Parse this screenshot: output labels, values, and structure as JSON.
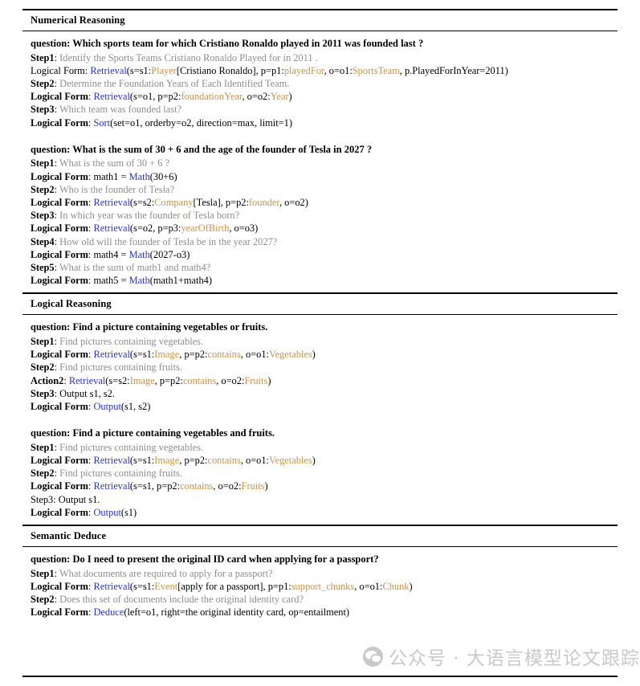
{
  "document": {
    "title": "Logical Form Reasoning Examples Table",
    "colors": {
      "operator": "#2a37d8",
      "type": "#d09344",
      "step_text": "#8e8e8e",
      "body_text": "#000000"
    }
  },
  "sections": [
    {
      "heading": "Numerical Reasoning",
      "examples": [
        {
          "question": "question: Which sports team for which Cristiano Ronaldo played in 2011 was founded last ?",
          "lines": [
            {
              "label": "Step1",
              "label_bold": true,
              "sep": ": ",
              "kind": "step",
              "parts": [
                {
                  "t": "Identify the Sports Teams Cristiano Ronaldo Played for in 2011 .",
                  "c": "step"
                }
              ]
            },
            {
              "label": "Logical Form",
              "label_bold": false,
              "sep": ": ",
              "kind": "form",
              "parts": [
                {
                  "t": "Retrieval",
                  "c": "op"
                },
                {
                  "t": "(s=s1:",
                  "c": "plain"
                },
                {
                  "t": "Player",
                  "c": "typ"
                },
                {
                  "t": "[Cristiano Ronaldo], p=p1:",
                  "c": "plain"
                },
                {
                  "t": "playedFor",
                  "c": "typ"
                },
                {
                  "t": ", o=o1:",
                  "c": "plain"
                },
                {
                  "t": "SportsTeam",
                  "c": "typ"
                },
                {
                  "t": ", p.PlayedForInYear=2011)",
                  "c": "plain"
                }
              ]
            },
            {
              "label": "Step2",
              "label_bold": true,
              "sep": ": ",
              "kind": "step",
              "parts": [
                {
                  "t": "Determine the Foundation Years of Each Identified Team.",
                  "c": "step"
                }
              ]
            },
            {
              "label": "Logical Form",
              "label_bold": true,
              "sep": ": ",
              "kind": "form",
              "parts": [
                {
                  "t": "Retrieval",
                  "c": "op"
                },
                {
                  "t": "(s=o1, p=p2:",
                  "c": "plain"
                },
                {
                  "t": "foundationYear",
                  "c": "typ"
                },
                {
                  "t": ", o=o2:",
                  "c": "plain"
                },
                {
                  "t": "Year",
                  "c": "typ"
                },
                {
                  "t": ")",
                  "c": "plain"
                }
              ]
            },
            {
              "label": "Step3",
              "label_bold": true,
              "sep": ": ",
              "kind": "step",
              "parts": [
                {
                  "t": "Which team was founded last?",
                  "c": "step"
                }
              ]
            },
            {
              "label": "Logical Form",
              "label_bold": true,
              "sep": ": ",
              "kind": "form",
              "parts": [
                {
                  "t": "Sort",
                  "c": "op"
                },
                {
                  "t": "(set=o1, orderby=o2, direction=max, limit=1)",
                  "c": "plain"
                }
              ]
            }
          ]
        },
        {
          "question": "question: What is the sum of 30 + 6 and the age of the founder of Tesla in 2027 ?",
          "lines": [
            {
              "label": "Step1",
              "label_bold": true,
              "sep": ": ",
              "kind": "step",
              "parts": [
                {
                  "t": "What is the sum of 30 + 6 ?",
                  "c": "step"
                }
              ]
            },
            {
              "label": "Logical Form",
              "label_bold": true,
              "sep": ": ",
              "kind": "form",
              "parts": [
                {
                  "t": "math1 = ",
                  "c": "plain"
                },
                {
                  "t": "Math",
                  "c": "op"
                },
                {
                  "t": "(30+6)",
                  "c": "plain"
                }
              ]
            },
            {
              "label": "Step2",
              "label_bold": true,
              "sep": ": ",
              "kind": "step",
              "parts": [
                {
                  "t": "Who is the founder of Tesla?",
                  "c": "step"
                }
              ]
            },
            {
              "label": "Logical Form",
              "label_bold": true,
              "sep": ": ",
              "kind": "form",
              "parts": [
                {
                  "t": "Retrieval",
                  "c": "op"
                },
                {
                  "t": "(s=s2:",
                  "c": "plain"
                },
                {
                  "t": "Company",
                  "c": "typ"
                },
                {
                  "t": "[Tesla], p=p2:",
                  "c": "plain"
                },
                {
                  "t": "founder",
                  "c": "typ"
                },
                {
                  "t": ", o=o2)",
                  "c": "plain"
                }
              ]
            },
            {
              "label": "Step3",
              "label_bold": true,
              "sep": ": ",
              "kind": "step",
              "parts": [
                {
                  "t": "In which year was the founder of Tesla born?",
                  "c": "step"
                }
              ]
            },
            {
              "label": "Logical Form",
              "label_bold": true,
              "sep": ": ",
              "kind": "form",
              "parts": [
                {
                  "t": "Retrieval",
                  "c": "op"
                },
                {
                  "t": "(s=o2, p=p3:",
                  "c": "plain"
                },
                {
                  "t": "yearOfBirth",
                  "c": "typ"
                },
                {
                  "t": ", o=o3)",
                  "c": "plain"
                }
              ]
            },
            {
              "label": "Step4",
              "label_bold": true,
              "sep": ": ",
              "kind": "step",
              "parts": [
                {
                  "t": "How old will the founder of Tesla be in the year 2027?",
                  "c": "step"
                }
              ]
            },
            {
              "label": "Logical Form",
              "label_bold": true,
              "sep": ": ",
              "kind": "form",
              "parts": [
                {
                  "t": "math4 = ",
                  "c": "plain"
                },
                {
                  "t": "Math",
                  "c": "op"
                },
                {
                  "t": "(2027-o3)",
                  "c": "plain"
                }
              ]
            },
            {
              "label": "Step5",
              "label_bold": true,
              "sep": ": ",
              "kind": "step",
              "parts": [
                {
                  "t": "What is the sum of math1 and math4?",
                  "c": "step"
                }
              ]
            },
            {
              "label": "Logical Form",
              "label_bold": true,
              "sep": ": ",
              "kind": "form",
              "parts": [
                {
                  "t": "math5 = ",
                  "c": "plain"
                },
                {
                  "t": "Math",
                  "c": "op"
                },
                {
                  "t": "(math1+math4)",
                  "c": "plain"
                }
              ]
            }
          ]
        }
      ]
    },
    {
      "heading": "Logical Reasoning",
      "examples": [
        {
          "question": "question: Find a picture containing vegetables or fruits.",
          "lines": [
            {
              "label": "Step1",
              "label_bold": true,
              "sep": ": ",
              "kind": "step",
              "parts": [
                {
                  "t": "Find pictures containing vegetables.",
                  "c": "step"
                }
              ]
            },
            {
              "label": "Logical Form",
              "label_bold": true,
              "sep": ": ",
              "kind": "form",
              "parts": [
                {
                  "t": "Retrieval",
                  "c": "op"
                },
                {
                  "t": "(s=s1:",
                  "c": "plain"
                },
                {
                  "t": "Image",
                  "c": "typ"
                },
                {
                  "t": ", p=p2:",
                  "c": "plain"
                },
                {
                  "t": "contains",
                  "c": "typ"
                },
                {
                  "t": ", o=o1:",
                  "c": "plain"
                },
                {
                  "t": "Vegetables",
                  "c": "typ"
                },
                {
                  "t": ")",
                  "c": "plain"
                }
              ]
            },
            {
              "label": "Step2",
              "label_bold": true,
              "sep": ": ",
              "kind": "step",
              "parts": [
                {
                  "t": "Find pictures containing fruits.",
                  "c": "step"
                }
              ]
            },
            {
              "label": "Action2",
              "label_bold": true,
              "sep": ": ",
              "kind": "form",
              "parts": [
                {
                  "t": "Retrieval",
                  "c": "op"
                },
                {
                  "t": "(s=s2:",
                  "c": "plain"
                },
                {
                  "t": "Image",
                  "c": "typ"
                },
                {
                  "t": ", p=p2:",
                  "c": "plain"
                },
                {
                  "t": "contains",
                  "c": "typ"
                },
                {
                  "t": ", o=o2:",
                  "c": "plain"
                },
                {
                  "t": "Fruits",
                  "c": "typ"
                },
                {
                  "t": ")",
                  "c": "plain"
                }
              ]
            },
            {
              "label": "Step3",
              "label_bold": true,
              "sep": ": ",
              "kind": "form",
              "parts": [
                {
                  "t": "Output s1, s2.",
                  "c": "plain"
                }
              ]
            },
            {
              "label": "Logical Form",
              "label_bold": true,
              "sep": ": ",
              "kind": "form",
              "parts": [
                {
                  "t": "Output",
                  "c": "op"
                },
                {
                  "t": "(s1, s2)",
                  "c": "plain"
                }
              ]
            }
          ]
        },
        {
          "question": "question: Find a picture containing vegetables and fruits.",
          "lines": [
            {
              "label": "Step1",
              "label_bold": true,
              "sep": ": ",
              "kind": "step",
              "parts": [
                {
                  "t": "Find pictures containing vegetables.",
                  "c": "step"
                }
              ]
            },
            {
              "label": "Logical Form",
              "label_bold": true,
              "sep": ": ",
              "kind": "form",
              "parts": [
                {
                  "t": "Retrieval",
                  "c": "op"
                },
                {
                  "t": "(s=s1:",
                  "c": "plain"
                },
                {
                  "t": "Image",
                  "c": "typ"
                },
                {
                  "t": ", p=p2:",
                  "c": "plain"
                },
                {
                  "t": "contains",
                  "c": "typ"
                },
                {
                  "t": ", o=o1:",
                  "c": "plain"
                },
                {
                  "t": "Vegetables",
                  "c": "typ"
                },
                {
                  "t": ")",
                  "c": "plain"
                }
              ]
            },
            {
              "label": "Step2",
              "label_bold": true,
              "sep": ": ",
              "kind": "step",
              "parts": [
                {
                  "t": "Find pictures containing fruits.",
                  "c": "step"
                }
              ]
            },
            {
              "label": "Logical Form",
              "label_bold": true,
              "sep": ": ",
              "kind": "form",
              "parts": [
                {
                  "t": "Retrieval",
                  "c": "op"
                },
                {
                  "t": "(s=s1, p=p2:",
                  "c": "plain"
                },
                {
                  "t": "contains",
                  "c": "typ"
                },
                {
                  "t": ", o=o2:",
                  "c": "plain"
                },
                {
                  "t": "Fruits",
                  "c": "typ"
                },
                {
                  "t": ")",
                  "c": "plain"
                }
              ]
            },
            {
              "label": "Step3",
              "label_bold": false,
              "sep": ": ",
              "kind": "form",
              "parts": [
                {
                  "t": "Output s1.",
                  "c": "plain"
                }
              ]
            },
            {
              "label": "Logical Form",
              "label_bold": true,
              "sep": ": ",
              "kind": "form",
              "parts": [
                {
                  "t": "Output",
                  "c": "op"
                },
                {
                  "t": "(s1)",
                  "c": "plain"
                }
              ]
            }
          ]
        }
      ]
    },
    {
      "heading": "Semantic Deduce",
      "examples": [
        {
          "question": "question: Do I need to present the original ID card when applying for a passport?",
          "lines": [
            {
              "label": "Step1",
              "label_bold": true,
              "sep": ": ",
              "kind": "step",
              "parts": [
                {
                  "t": "What documents are required to apply for a passport?",
                  "c": "step"
                }
              ]
            },
            {
              "label": "Logical Form",
              "label_bold": true,
              "sep": ": ",
              "kind": "form",
              "parts": [
                {
                  "t": "Retrieval",
                  "c": "op"
                },
                {
                  "t": "(s=s1:",
                  "c": "plain"
                },
                {
                  "t": "Event",
                  "c": "typ"
                },
                {
                  "t": "[apply for a passport], p=p1:",
                  "c": "plain"
                },
                {
                  "t": "support_chunks",
                  "c": "typ"
                },
                {
                  "t": ", o=o1:",
                  "c": "plain"
                },
                {
                  "t": "Chunk",
                  "c": "typ"
                },
                {
                  "t": ")",
                  "c": "plain"
                }
              ]
            },
            {
              "label": "Step2",
              "label_bold": true,
              "sep": ": ",
              "kind": "step",
              "parts": [
                {
                  "t": "Does this set of documents include the original identity card?",
                  "c": "step"
                }
              ]
            },
            {
              "label": "Logical Form",
              "label_bold": true,
              "sep": ": ",
              "kind": "form",
              "parts": [
                {
                  "t": "Deduce",
                  "c": "op"
                },
                {
                  "t": "(left=o1, right=the original identity card, op=entailment)",
                  "c": "plain"
                }
              ]
            }
          ]
        }
      ]
    }
  ],
  "watermark": {
    "icon": "wechat-official-account-icon",
    "text": "公众号 · 大语言模型论文跟踪"
  }
}
